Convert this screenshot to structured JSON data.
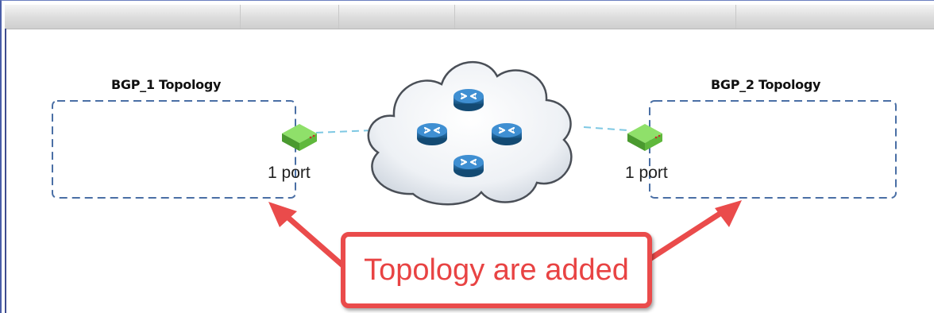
{
  "toolbar": {
    "label": ""
  },
  "topologies": [
    {
      "title": "BGP_1 Topology",
      "port_label": "1 port"
    },
    {
      "title": "BGP_2 Topology",
      "port_label": "1 port"
    }
  ],
  "network": {
    "icon": "cloud-network-icon",
    "router_icons": [
      "router-icon",
      "router-icon",
      "router-icon",
      "router-icon"
    ]
  },
  "annotation": {
    "text": "Topology are added",
    "color": "#e84343"
  },
  "colors": {
    "dashed_border": "#4a6fa5",
    "link": "#7ec8e3",
    "port_green": "#6cc04a",
    "router_blue": "#1f5f96",
    "callout_red": "#ea4b4b"
  }
}
